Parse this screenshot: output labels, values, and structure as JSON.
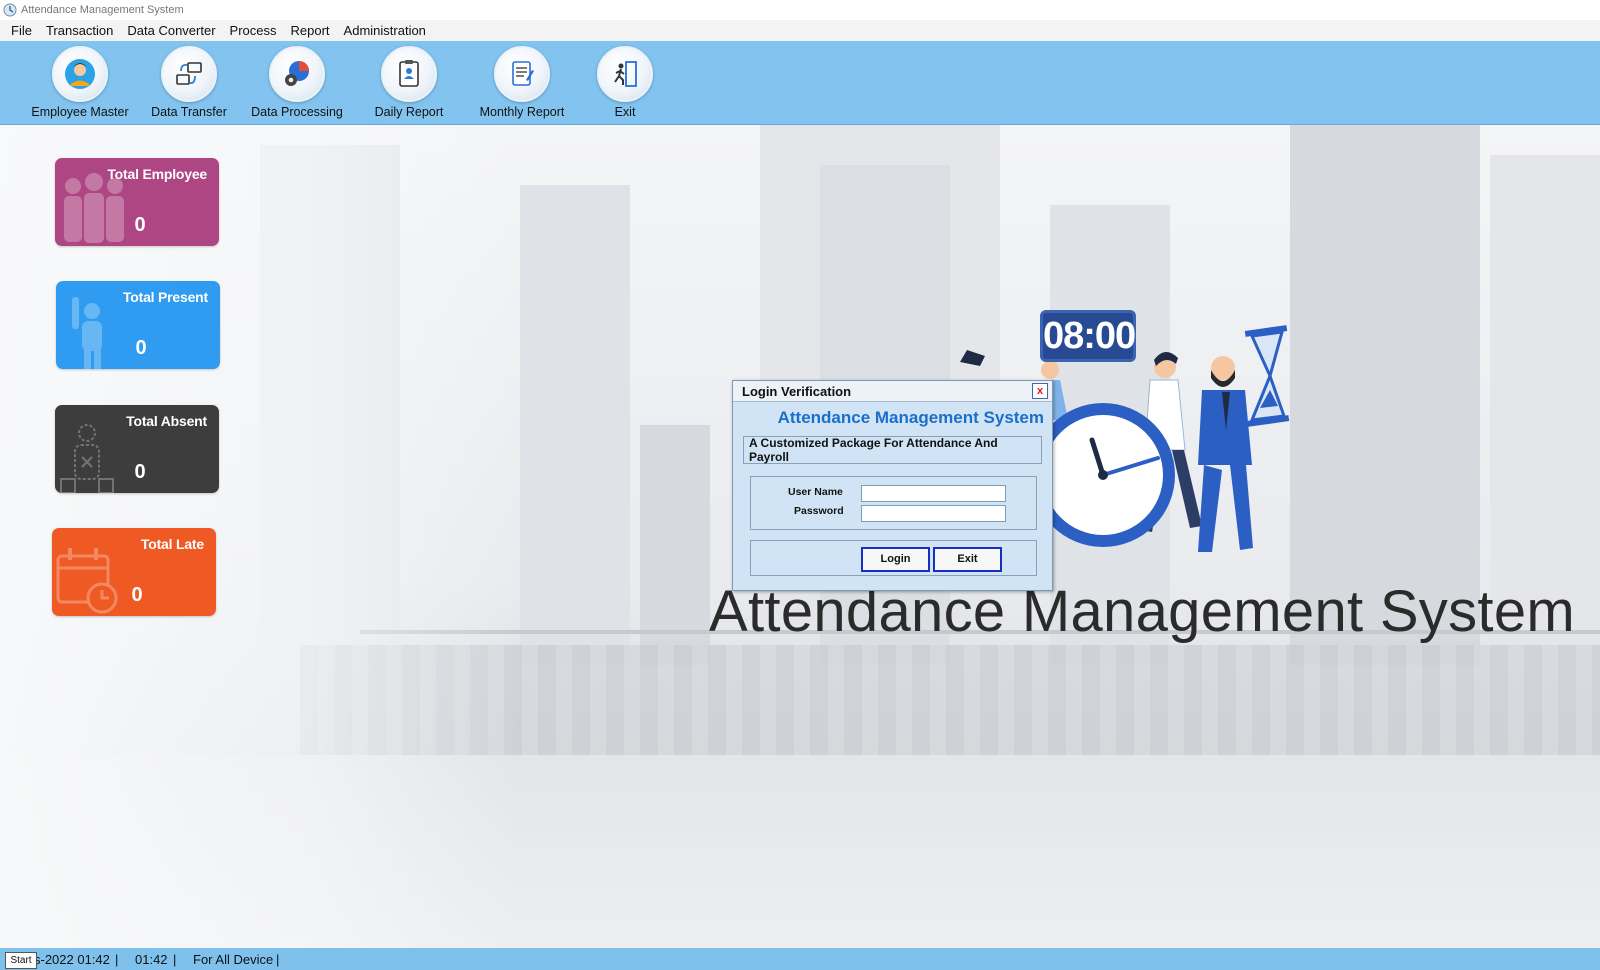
{
  "window": {
    "title": "Attendance Management System"
  },
  "menu": [
    "File",
    "Transaction",
    "Data Converter",
    "Process",
    "Report",
    "Administration"
  ],
  "toolbar": [
    {
      "label": "Employee Master",
      "icon": "employee-icon"
    },
    {
      "label": "Data Transfer",
      "icon": "transfer-icon"
    },
    {
      "label": "Data Processing",
      "icon": "processing-icon"
    },
    {
      "label": "Daily Report",
      "icon": "daily-report-icon"
    },
    {
      "label": "Monthly Report",
      "icon": "monthly-report-icon"
    },
    {
      "label": "Exit",
      "icon": "exit-door-icon"
    }
  ],
  "cards": {
    "employee": {
      "title": "Total Employee",
      "value": "0",
      "color": "#ad4683"
    },
    "present": {
      "title": "Total Present",
      "value": "0",
      "color": "#2f9cf1"
    },
    "absent": {
      "title": "Total Absent",
      "value": "0",
      "color": "#3d3d3d"
    },
    "late": {
      "title": "Total Late",
      "value": "0",
      "color": "#ef5a24"
    }
  },
  "illustration": {
    "clock_time": "08:00"
  },
  "banner": {
    "title": "Attendance Management System"
  },
  "login": {
    "header": "Login Verification",
    "close": "x",
    "app_name": "Attendance Management System",
    "subtitle": "A Customized Package For Attendance And Payroll",
    "username_label": "User Name",
    "password_label": "Password",
    "username_value": "",
    "password_value": "",
    "login_button": "Login",
    "exit_button": "Exit"
  },
  "status": {
    "start": "Start",
    "datetime": "s-2022 01:42",
    "time": "01:42",
    "device": "For All Device",
    "sep": "|"
  },
  "colors": {
    "toolbar_bg": "#82c4ef",
    "accent": "#1c6fc8"
  }
}
